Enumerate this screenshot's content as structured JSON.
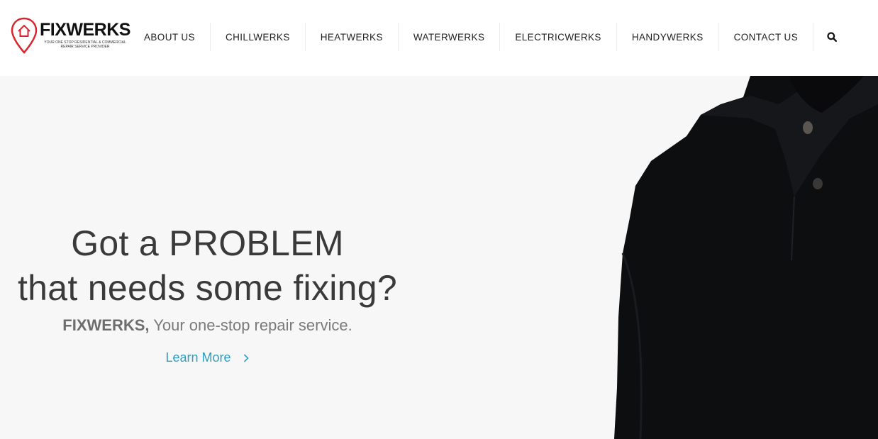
{
  "header": {
    "logo": {
      "wordmark": "FIXWERKS",
      "tagline": "YOUR ONE STOP RESIDENTIAL & COMMERCIAL REPAIR SERVICE PROVIDER",
      "pin_color": "#d9262e"
    },
    "nav": {
      "items": [
        {
          "label": "ABOUT US"
        },
        {
          "label": "CHILLWERKS"
        },
        {
          "label": "HEATWERKS"
        },
        {
          "label": "WATERWERKS"
        },
        {
          "label": "ELECTRICWERKS"
        },
        {
          "label": "HANDYWERKS"
        },
        {
          "label": "CONTACT US"
        }
      ],
      "search_icon": "search-icon"
    }
  },
  "hero": {
    "headline_line1": "Got a PROBLEM",
    "headline_line2": "that needs some fixing?",
    "brand": "FIXWERKS,",
    "subline": " Your one-stop repair service.",
    "cta_label": "Learn More",
    "cta_icon": "chevron-right-icon",
    "cta_color": "#2b9ec6",
    "background_color": "#f7f7f7"
  }
}
